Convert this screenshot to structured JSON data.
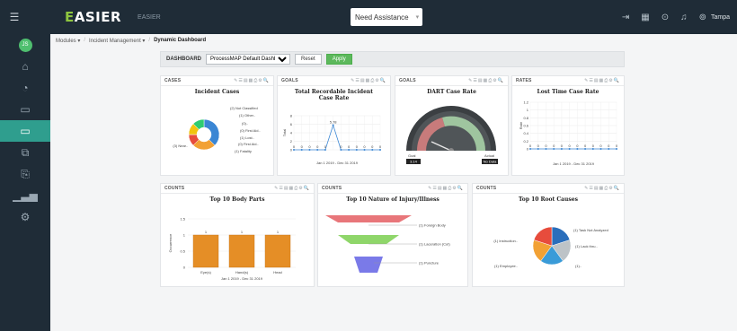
{
  "header": {
    "brand_prefix": "E",
    "brand_rest": "ASIER",
    "brand_sub": "EASIER",
    "need_assistance": "Need Assistance",
    "user": "Tampa"
  },
  "sidebar": {
    "avatar": "JS"
  },
  "breadcrumb": {
    "modules": "Modules ▾",
    "incident": "Incident Management ▾",
    "current": "Dynamic Dashboard"
  },
  "filter": {
    "label": "DASHBOARD",
    "selected": "ProcessMAP Default Dashboar",
    "reset": "Reset",
    "apply": "Apply"
  },
  "tools": "✎☰▤▦⎙⚙🔍",
  "cards": {
    "cases": {
      "label": "CASES",
      "title": "Incident Cases"
    },
    "goals1": {
      "label": "GOALS",
      "title": "Total Recordable Incident Case Rate"
    },
    "goals2": {
      "label": "GOALS",
      "title": "DART Case Rate"
    },
    "rates": {
      "label": "RATES",
      "title": "Lost Time Case Rate"
    },
    "counts1": {
      "label": "COUNTS",
      "title": "Top 10 Body Parts"
    },
    "counts2": {
      "label": "COUNTS",
      "title": "Top 10 Nature of Injury/Illness"
    },
    "counts3": {
      "label": "COUNTS",
      "title": "Top 10 Root Causes"
    }
  },
  "chart_data": [
    {
      "type": "pie",
      "title": "Incident Cases",
      "labels": [
        "(3) Near..",
        "(2) Not Classified",
        "(1) Other..",
        "(0)..",
        "(0) First Aid..",
        "(1) Lost..",
        "(0) First Aid..",
        "(1) Fatality"
      ],
      "values": [
        3,
        2,
        1,
        0,
        0,
        1,
        0,
        1
      ],
      "colors": [
        "#3a86d4",
        "#f2a134",
        "#e74c3c",
        "#95a5a6",
        "#7f8c8d",
        "#f1c40f",
        "#bdc3c7",
        "#2ecc71"
      ]
    },
    {
      "type": "line",
      "title": "Total Recordable Incident Case Rate",
      "ylabel": "Total",
      "ylim": [
        0,
        8
      ],
      "yticks": [
        0,
        2,
        4,
        6,
        8
      ],
      "values": [
        0,
        0,
        0,
        0,
        0,
        5.78,
        0,
        0,
        0,
        0,
        0,
        0
      ],
      "peak_label": "5.78",
      "date_range": "Jan 1 2019 - Dec 31 2019"
    },
    {
      "type": "gauge",
      "title": "DART Case Rate",
      "goal_label": "Goal",
      "goal_value": "3.14",
      "actual_label": "Actual",
      "actual_value": "No Data"
    },
    {
      "type": "line",
      "title": "Lost Time Case Rate",
      "ylabel": "Rate",
      "ylim": [
        0,
        1.2
      ],
      "yticks": [
        0,
        0.2,
        0.4,
        0.6,
        0.8,
        1,
        1.2
      ],
      "values": [
        0,
        0,
        0,
        0,
        0,
        0,
        0,
        0,
        0,
        0,
        0,
        0
      ],
      "date_range": "Jan 1 2019 - Dec 31 2019"
    },
    {
      "type": "bar",
      "title": "Top 10 Body Parts",
      "categories": [
        "Eye(s)",
        "Hand(s)",
        "Head"
      ],
      "values": [
        1,
        1,
        1
      ],
      "ylabel": "Occurrence",
      "ylim": [
        0,
        1.5
      ],
      "yticks": [
        0,
        0.5,
        1,
        1.5
      ],
      "date_range": "Jan 1 2019 - Dec 31 2019"
    },
    {
      "type": "funnel",
      "title": "Top 10 Nature of Injury/Illness",
      "labels": [
        "(1) Foreign Body",
        "(1) Laceration (Cut)",
        "(1) Puncture"
      ],
      "values": [
        1,
        1,
        1
      ],
      "colors": [
        "#e8767a",
        "#8fd66a",
        "#7a7ae8"
      ]
    },
    {
      "type": "pie",
      "title": "Top 10 Root Causes",
      "labels": [
        "(1) Task Not Analyzed",
        "(1) Lack thru..",
        "(1)..",
        "(1) Employee..",
        "(1) Instruction.."
      ],
      "values": [
        1,
        1,
        1,
        1,
        1
      ],
      "colors": [
        "#2a6ebb",
        "#bdc3c7",
        "#3a9bd8",
        "#f2a134",
        "#e74c3c"
      ]
    }
  ]
}
